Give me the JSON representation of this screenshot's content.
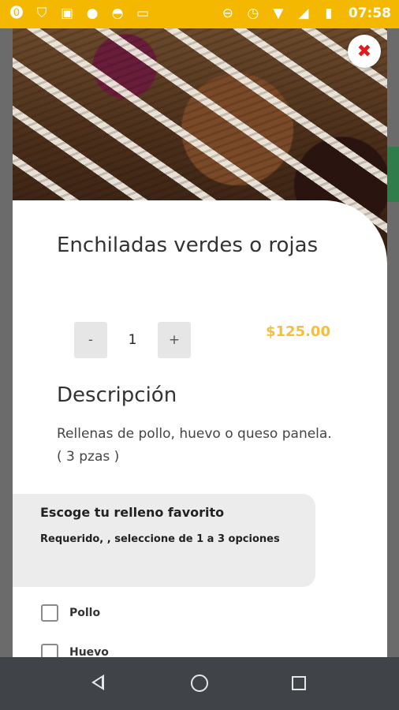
{
  "status_bar": {
    "time": "07:58",
    "icons": [
      "alert-icon",
      "shield-icon",
      "image-icon",
      "blob-icon",
      "incognito-icon",
      "laptop-icon",
      "dnd-icon",
      "alarm-icon",
      "wifi-icon",
      "signal-icon",
      "battery-icon"
    ]
  },
  "product": {
    "title": "Enchiladas verdes o rojas",
    "quantity": "1",
    "minus_label": "-",
    "plus_label": "+",
    "price": "$125.00",
    "description_heading": "Descripción",
    "description": "Rellenas de pollo, huevo o queso panela. ( 3 pzas )"
  },
  "options": {
    "title": "Escoge tu relleno favorito",
    "subtitle": "Requerido, , seleccione de 1 a 3 opciones",
    "choices": [
      "Pollo",
      "Huevo"
    ]
  },
  "close_label": "✖",
  "colors": {
    "status_bar": "#f5b800",
    "price": "#f5be3e",
    "close": "#e01b1b",
    "navbar": "#404449"
  }
}
